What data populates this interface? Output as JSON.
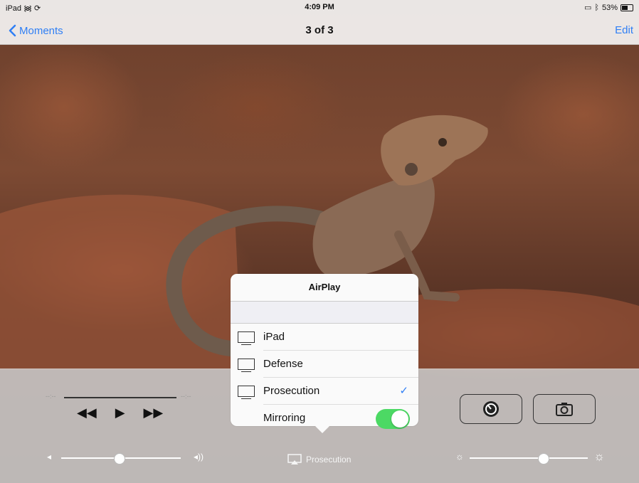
{
  "status_bar": {
    "device": "iPad",
    "time": "4:09 PM",
    "battery_percent": "53%"
  },
  "nav_bar": {
    "back_label": "Moments",
    "title": "3 of 3",
    "edit_label": "Edit"
  },
  "media": {
    "elapsed": "--:--",
    "remaining": "--:--",
    "rewind_icon": "◀◀",
    "play_icon": "▶",
    "forward_icon": "▶▶",
    "volume_level": 0.48,
    "brightness_level": 0.62
  },
  "airplay": {
    "title": "AirPlay",
    "devices": [
      {
        "label": "iPad",
        "selected": false
      },
      {
        "label": "Defense",
        "selected": false
      },
      {
        "label": "Prosecution",
        "selected": true
      }
    ],
    "check_mark": "✓",
    "mirroring_label": "Mirroring",
    "mirroring_on": true,
    "current_target": "Prosecution"
  },
  "colors": {
    "accent": "#2f7ff5",
    "toggle_on": "#4cd964"
  }
}
